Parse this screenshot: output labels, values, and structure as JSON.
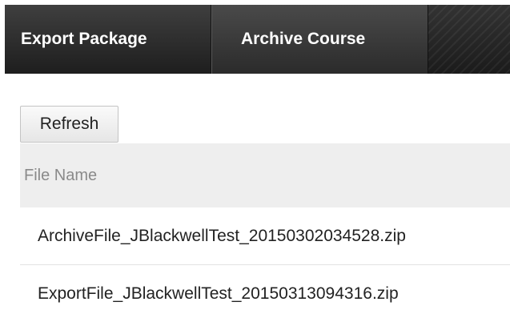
{
  "toolbar": {
    "export_label": "Export Package",
    "archive_label": "Archive Course"
  },
  "actions": {
    "refresh_label": "Refresh"
  },
  "table": {
    "header": "File Name",
    "rows": [
      "ArchiveFile_JBlackwellTest_20150302034528.zip",
      "ExportFile_JBlackwellTest_20150313094316.zip"
    ]
  }
}
